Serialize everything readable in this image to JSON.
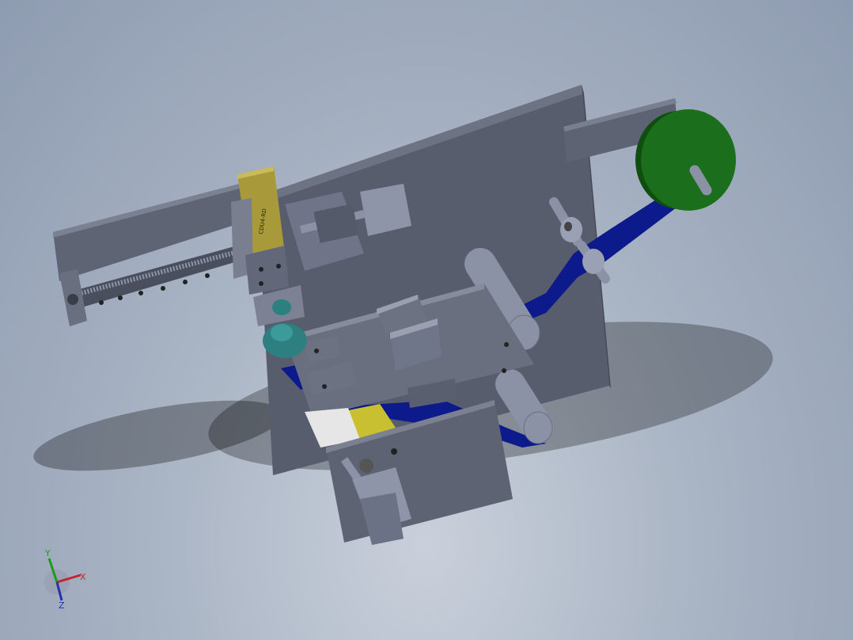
{
  "viewport": {
    "background_top": "#8e9cb1",
    "background_bottom": "#c9d0db"
  },
  "colors": {
    "plate": "#585d6e",
    "plate_edge": "#474b5a",
    "plate_top": "#6e7384",
    "steel": "#8b92a6",
    "steel_light": "#b3b9c9",
    "belt": "#0d1a8c",
    "spool": "#1b6e1b",
    "spool_dark": "#0f4d10",
    "cylinder": "#a89a3a",
    "collar": "#2e7f80",
    "roll_yellow": "#c8c030",
    "roll_white": "#e6e6e6"
  },
  "labels": {
    "cylinder_marking": "CDU4-RD"
  },
  "triad": {
    "x_label": "X",
    "y_label": "Y",
    "z_label": "Z"
  }
}
